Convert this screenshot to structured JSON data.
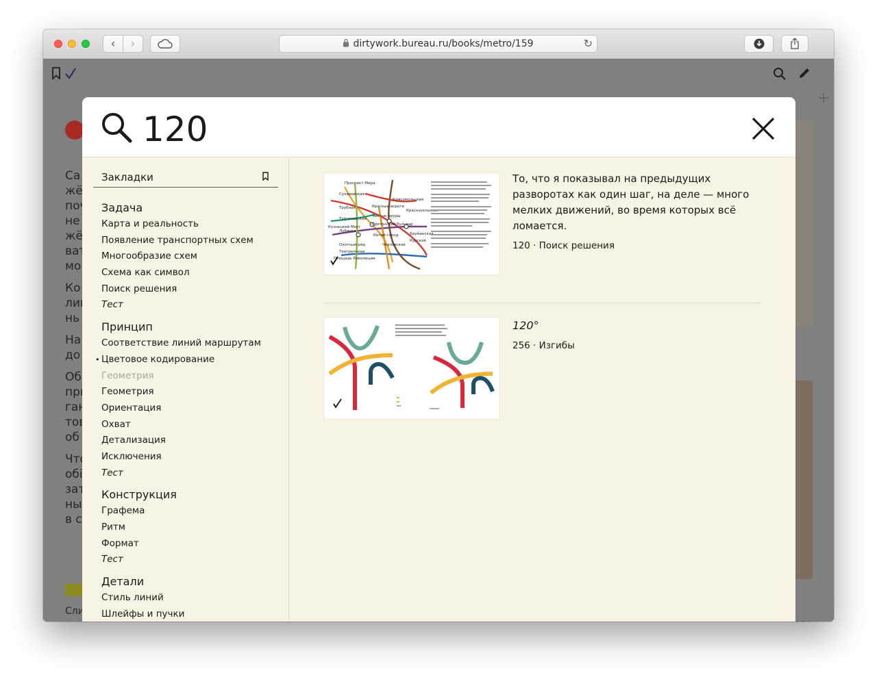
{
  "browser": {
    "url": "dirtywork.bureau.ru/books/metro/159",
    "back_glyph": "‹",
    "forward_glyph": "›",
    "reload_glyph": "↻",
    "new_tab_glyph": "+"
  },
  "page": {
    "page_number": "159",
    "background_lines": [
      "Са",
      "жё",
      "поч",
      "не",
      "жё",
      "ват",
      "мо",
      "Ко",
      "лин",
      "нь",
      "На",
      "до",
      "Об",
      "при",
      "ган",
      "тов",
      "об",
      "Что",
      "обі",
      "зат",
      "ны",
      "в ст",
      "Сли"
    ],
    "line_colors": [
      "#d13a2f",
      "#2e8a4e",
      "#1f7fb5",
      "#7a4a2a",
      "#c8681e",
      "#7a3f8a",
      "#b0306d",
      "#888888",
      "#8db53a",
      "#c9b44a",
      "#8fa3b8"
    ]
  },
  "search": {
    "query": "120"
  },
  "sidebar": {
    "bookmarks_label": "Закладки",
    "sections": [
      {
        "title": "Задача",
        "items": [
          {
            "label": "Карта и реальность"
          },
          {
            "label": "Появление транспортных схем"
          },
          {
            "label": "Многообразие схем"
          },
          {
            "label": "Схема как символ"
          },
          {
            "label": "Поиск решения"
          },
          {
            "label": "Тест",
            "italic": true
          }
        ]
      },
      {
        "title": "Принцип",
        "items": [
          {
            "label": "Соответствие линий маршрутам"
          },
          {
            "label": "Цветовое кодирование",
            "current": true
          },
          {
            "label": "Геометрия",
            "dim": true
          },
          {
            "label": "Геометрия"
          },
          {
            "label": "Ориентация"
          },
          {
            "label": "Охват"
          },
          {
            "label": "Детализация"
          },
          {
            "label": "Исключения"
          },
          {
            "label": "Тест",
            "italic": true
          }
        ]
      },
      {
        "title": "Конструкция",
        "items": [
          {
            "label": "Графема"
          },
          {
            "label": "Ритм"
          },
          {
            "label": "Формат"
          },
          {
            "label": "Тест",
            "italic": true
          }
        ]
      },
      {
        "title": "Детали",
        "items": [
          {
            "label": "Стиль линий"
          },
          {
            "label": "Шлейфы и пучки"
          }
        ]
      }
    ]
  },
  "results": [
    {
      "snippet": "То, что я показывал на предыдущих разворо­тах как один шаг, на деле — много мелких движений, во время которых всё ломается.",
      "meta": "120 · Поиск решения",
      "thumb_labels": [
        "Проспект Мира",
        "Сухаревская",
        "Трубная",
        "Тургеневская",
        "Лубянка",
        "Охотный ряд",
        "Театральная",
        "Кузнецкий Мост",
        "Красные ворота",
        "Комсомольская",
        "Чистые пруды",
        "Сретенский бульвар",
        "Китай-город",
        "Чкаловская",
        "Площадь Революции",
        "Красносельская",
        "Курская",
        "Бауманская"
      ]
    },
    {
      "title": "120°",
      "meta": "256 · Изгибы"
    }
  ],
  "colors": {
    "panel_bg": "#f7f4e4",
    "accent_red": "#d8283c",
    "accent_teal": "#6aa89a",
    "accent_yellow": "#f2b233",
    "accent_navy": "#1f4e6b"
  }
}
